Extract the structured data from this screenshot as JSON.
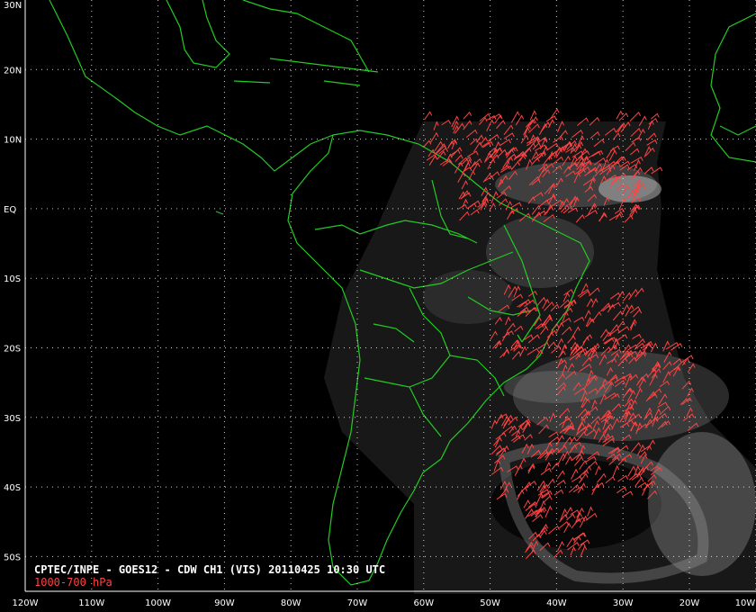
{
  "caption": {
    "title": "CPTEC/INPE - GOES12 - CDW CH1 (VIS) 20110425 10:30 UTC",
    "level": "1000-700 hPa"
  },
  "axes": {
    "lat_labels": [
      "30N",
      "20N",
      "10N",
      "EQ",
      "10S",
      "20S",
      "30S",
      "40S",
      "50S"
    ],
    "lon_labels": [
      "120W",
      "110W",
      "100W",
      "90W",
      "80W",
      "70W",
      "60W",
      "50W",
      "40W",
      "30W",
      "20W",
      "10W"
    ]
  },
  "colors": {
    "background": "#000000",
    "coastline": "#22cc22",
    "wind_barbs": "#ff4444",
    "grid": "#ffffff",
    "text": "#ffffff"
  },
  "wind_regions": [
    {
      "lon_min": -60,
      "lon_max": -25,
      "lat_min": 5,
      "lat_max": 13
    },
    {
      "lon_min": -55,
      "lon_max": -28,
      "lat_min": -2,
      "lat_max": 8
    },
    {
      "lon_min": -50,
      "lon_max": -28,
      "lat_min": -22,
      "lat_max": -12
    },
    {
      "lon_min": -40,
      "lon_max": -20,
      "lat_min": -32,
      "lat_max": -20
    },
    {
      "lon_min": -50,
      "lon_max": -25,
      "lat_min": -42,
      "lat_max": -30
    },
    {
      "lon_min": -45,
      "lon_max": -35,
      "lat_min": -51,
      "lat_max": -42
    }
  ]
}
